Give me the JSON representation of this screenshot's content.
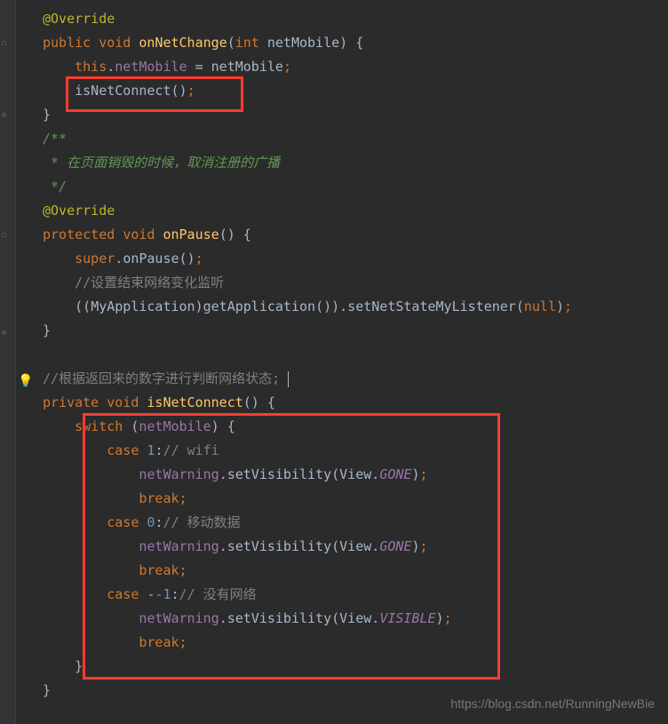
{
  "code": {
    "l1_annotation": "@Override",
    "l2_public": "public",
    "l2_void": "void",
    "l2_method": "onNetChange",
    "l2_int": "int",
    "l2_param": "netMobile",
    "l3_this": "this",
    "l3_field": "netMobile",
    "l3_assign": "netMobile",
    "l4_call": "isNetConnect",
    "l6_c1": "/**",
    "l7_c2": " * 在页面销毁的时候，取消注册的广播",
    "l8_c3": " */",
    "l9_annotation": "@Override",
    "l10_protected": "protected",
    "l10_void": "void",
    "l10_method": "onPause",
    "l11_super": "super",
    "l11_call": "onPause",
    "l12_comment": "//设置结束网络变化监听",
    "l13_cast": "MyApplication",
    "l13_getapp": "getApplication",
    "l13_setnet": "setNetStateMyListener",
    "l13_null": "null",
    "l16_comment": "//根据返回来的数字进行判断网络状态; ",
    "l17_private": "private",
    "l17_void": "void",
    "l17_method": "isNetConnect",
    "l18_switch": "switch",
    "l18_var": "netMobile",
    "l19_case": "case",
    "l19_val": "1",
    "l19_comment": "// wifi",
    "l20_field": "netWarning",
    "l20_method": "setVisibility",
    "l20_view": "View",
    "l20_const": "GONE",
    "l21_break": "break",
    "l22_case": "case",
    "l22_val": "0",
    "l22_comment": "// 移动数据",
    "l23_field": "netWarning",
    "l23_method": "setVisibility",
    "l23_view": "View",
    "l23_const": "GONE",
    "l24_break": "break",
    "l25_case": "case",
    "l25_val": "-1",
    "l25_comment": "// 没有网络",
    "l26_field": "netWarning",
    "l26_method": "setVisibility",
    "l26_view": "View",
    "l26_const": "VISIBLE",
    "l27_break": "break"
  },
  "watermark": "https://blog.csdn.net/RunningNewBie",
  "icons": {
    "bulb": "💡"
  }
}
